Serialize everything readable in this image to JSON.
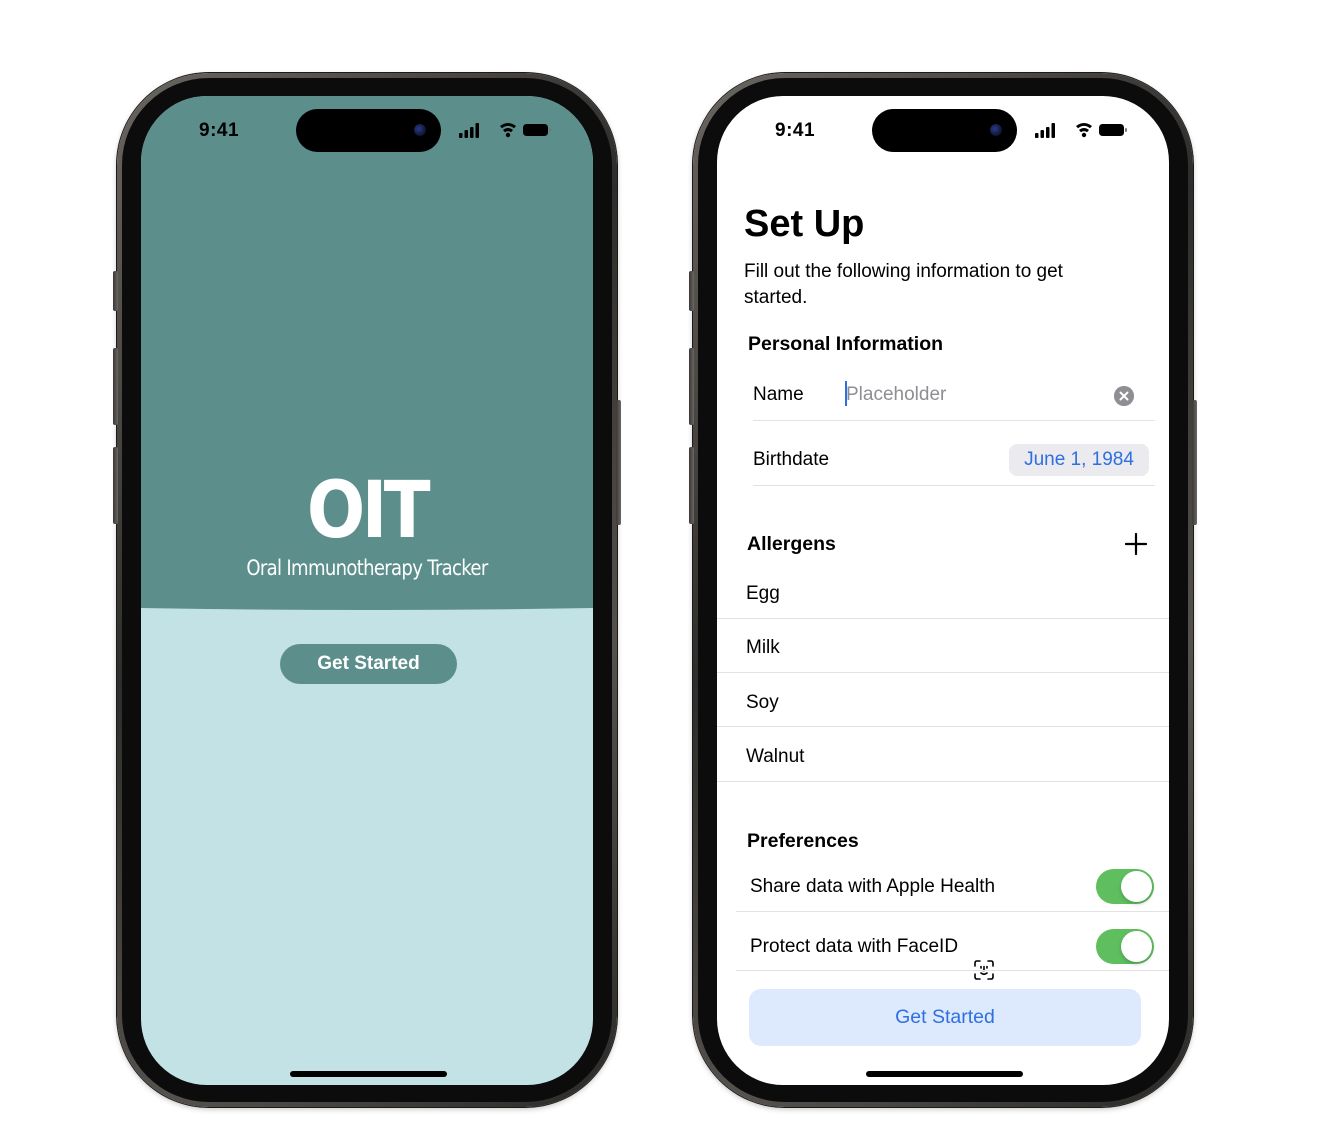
{
  "status_bar": {
    "time": "9:41"
  },
  "splash": {
    "title": "OIT",
    "subtitle": "Oral Immunotherapy Tracker",
    "cta_label": "Get Started",
    "colors": {
      "top": "#5c8f8c",
      "bottom": "#c3e2e6"
    }
  },
  "setup": {
    "title": "Set Up",
    "subtitle": "Fill out the following information to get started.",
    "personal_information": {
      "header": "Personal Information",
      "name_label": "Name",
      "name_placeholder": "Placeholder",
      "name_value": "",
      "birthdate_label": "Birthdate",
      "birthdate_value": "June 1, 1984"
    },
    "allergens": {
      "header": "Allergens",
      "items": [
        "Egg",
        "Milk",
        "Soy",
        "Walnut"
      ]
    },
    "preferences": {
      "header": "Preferences",
      "share_health_label": "Share data with Apple Health",
      "share_health_on": true,
      "faceid_label": "Protect data with FaceID",
      "faceid_on": true
    },
    "cta_label": "Get Started",
    "colors": {
      "accent": "#2f6fe0",
      "toggle_on": "#5fbf5f",
      "cta_bg": "#dde9fc"
    }
  }
}
